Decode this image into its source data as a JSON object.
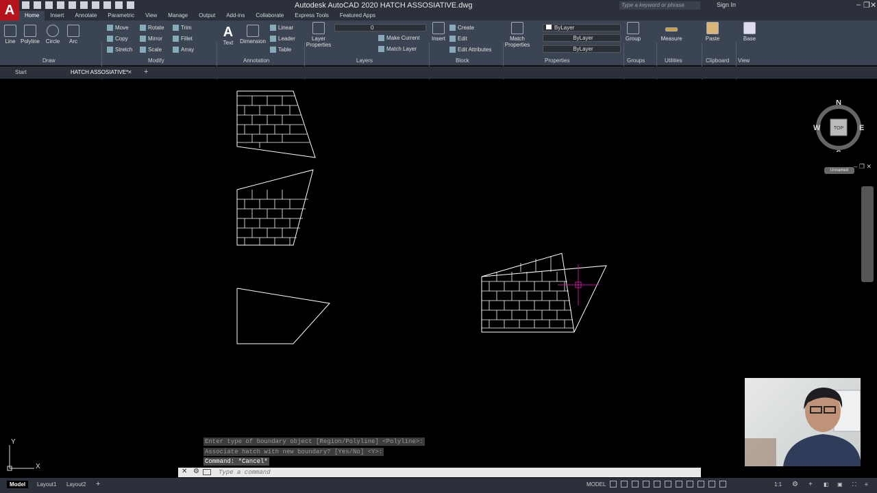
{
  "titlebar": {
    "title": "Autodesk AutoCAD 2020    HATCH ASSOSIATIVE.dwg",
    "search_placeholder": "Type a keyword or phrase",
    "signin": "Sign In"
  },
  "ribbon_tabs": [
    "Home",
    "Insert",
    "Annotate",
    "Parametric",
    "View",
    "Manage",
    "Output",
    "Add-ins",
    "Collaborate",
    "Express Tools",
    "Featured Apps"
  ],
  "draw": {
    "line": "Line",
    "polyline": "Polyline",
    "circle": "Circle",
    "arc": "Arc",
    "panel": "Draw"
  },
  "modify": {
    "move": "Move",
    "rotate": "Rotate",
    "trim": "Trim",
    "copy": "Copy",
    "mirror": "Mirror",
    "fillet": "Fillet",
    "stretch": "Stretch",
    "scale": "Scale",
    "array": "Array",
    "panel": "Modify"
  },
  "annotation": {
    "text": "Text",
    "dimension": "Dimension",
    "linear": "Linear",
    "leader": "Leader",
    "table": "Table",
    "panel": "Annotation"
  },
  "layers": {
    "layer_properties": "Layer\nProperties",
    "current_layer": "0",
    "make_current": "Make Current",
    "match_layer": "Match Layer",
    "panel": "Layers"
  },
  "block": {
    "insert": "Insert",
    "create": "Create",
    "edit": "Edit",
    "edit_attributes": "Edit Attributes",
    "panel": "Block"
  },
  "properties": {
    "match": "Match\nProperties",
    "color": "ByLayer",
    "linetype": "ByLayer",
    "lineweight": "ByLayer",
    "panel": "Properties"
  },
  "groups": {
    "group": "Group",
    "panel": "Groups"
  },
  "utilities": {
    "measure": "Measure",
    "panel": "Utilities"
  },
  "clipboard": {
    "paste": "Paste",
    "panel": "Clipboard"
  },
  "view": {
    "base": "Base",
    "panel": "View"
  },
  "doc_tabs": {
    "start": "Start",
    "current": "HATCH ASSOSIATIVE*"
  },
  "viewcube": {
    "n": "N",
    "s": "S",
    "e": "E",
    "w": "W",
    "top": "TOP",
    "ucs_name": "Unnamed"
  },
  "command": {
    "history": [
      "Enter type of boundary object [Region/Polyline] <Polyline>:",
      "Associate hatch with new boundary? [Yes/No] <Y>:",
      "Command: *Cancel*"
    ],
    "placeholder": "Type a command"
  },
  "ucs": {
    "x": "X",
    "y": "Y"
  },
  "layout_tabs": {
    "model": "Model",
    "layout1": "Layout1",
    "layout2": "Layout2"
  },
  "status": {
    "model": "MODEL",
    "scale": "1:1"
  }
}
